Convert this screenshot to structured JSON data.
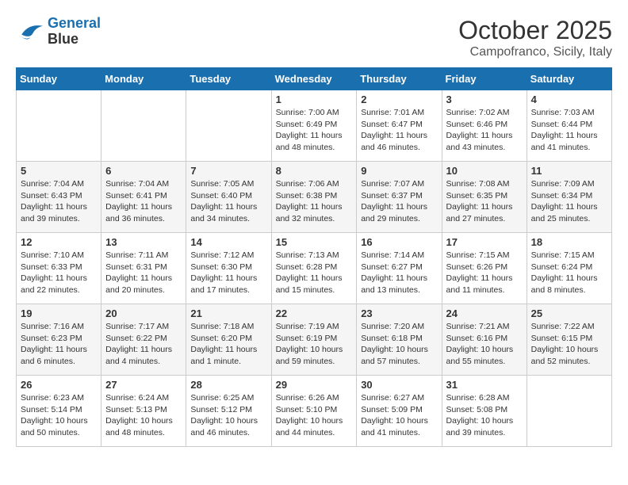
{
  "header": {
    "logo_line1": "General",
    "logo_line2": "Blue",
    "month": "October 2025",
    "location": "Campofranco, Sicily, Italy"
  },
  "weekdays": [
    "Sunday",
    "Monday",
    "Tuesday",
    "Wednesday",
    "Thursday",
    "Friday",
    "Saturday"
  ],
  "weeks": [
    [
      {
        "day": "",
        "info": ""
      },
      {
        "day": "",
        "info": ""
      },
      {
        "day": "",
        "info": ""
      },
      {
        "day": "1",
        "info": "Sunrise: 7:00 AM\nSunset: 6:49 PM\nDaylight: 11 hours\nand 48 minutes."
      },
      {
        "day": "2",
        "info": "Sunrise: 7:01 AM\nSunset: 6:47 PM\nDaylight: 11 hours\nand 46 minutes."
      },
      {
        "day": "3",
        "info": "Sunrise: 7:02 AM\nSunset: 6:46 PM\nDaylight: 11 hours\nand 43 minutes."
      },
      {
        "day": "4",
        "info": "Sunrise: 7:03 AM\nSunset: 6:44 PM\nDaylight: 11 hours\nand 41 minutes."
      }
    ],
    [
      {
        "day": "5",
        "info": "Sunrise: 7:04 AM\nSunset: 6:43 PM\nDaylight: 11 hours\nand 39 minutes."
      },
      {
        "day": "6",
        "info": "Sunrise: 7:04 AM\nSunset: 6:41 PM\nDaylight: 11 hours\nand 36 minutes."
      },
      {
        "day": "7",
        "info": "Sunrise: 7:05 AM\nSunset: 6:40 PM\nDaylight: 11 hours\nand 34 minutes."
      },
      {
        "day": "8",
        "info": "Sunrise: 7:06 AM\nSunset: 6:38 PM\nDaylight: 11 hours\nand 32 minutes."
      },
      {
        "day": "9",
        "info": "Sunrise: 7:07 AM\nSunset: 6:37 PM\nDaylight: 11 hours\nand 29 minutes."
      },
      {
        "day": "10",
        "info": "Sunrise: 7:08 AM\nSunset: 6:35 PM\nDaylight: 11 hours\nand 27 minutes."
      },
      {
        "day": "11",
        "info": "Sunrise: 7:09 AM\nSunset: 6:34 PM\nDaylight: 11 hours\nand 25 minutes."
      }
    ],
    [
      {
        "day": "12",
        "info": "Sunrise: 7:10 AM\nSunset: 6:33 PM\nDaylight: 11 hours\nand 22 minutes."
      },
      {
        "day": "13",
        "info": "Sunrise: 7:11 AM\nSunset: 6:31 PM\nDaylight: 11 hours\nand 20 minutes."
      },
      {
        "day": "14",
        "info": "Sunrise: 7:12 AM\nSunset: 6:30 PM\nDaylight: 11 hours\nand 17 minutes."
      },
      {
        "day": "15",
        "info": "Sunrise: 7:13 AM\nSunset: 6:28 PM\nDaylight: 11 hours\nand 15 minutes."
      },
      {
        "day": "16",
        "info": "Sunrise: 7:14 AM\nSunset: 6:27 PM\nDaylight: 11 hours\nand 13 minutes."
      },
      {
        "day": "17",
        "info": "Sunrise: 7:15 AM\nSunset: 6:26 PM\nDaylight: 11 hours\nand 11 minutes."
      },
      {
        "day": "18",
        "info": "Sunrise: 7:15 AM\nSunset: 6:24 PM\nDaylight: 11 hours\nand 8 minutes."
      }
    ],
    [
      {
        "day": "19",
        "info": "Sunrise: 7:16 AM\nSunset: 6:23 PM\nDaylight: 11 hours\nand 6 minutes."
      },
      {
        "day": "20",
        "info": "Sunrise: 7:17 AM\nSunset: 6:22 PM\nDaylight: 11 hours\nand 4 minutes."
      },
      {
        "day": "21",
        "info": "Sunrise: 7:18 AM\nSunset: 6:20 PM\nDaylight: 11 hours\nand 1 minute."
      },
      {
        "day": "22",
        "info": "Sunrise: 7:19 AM\nSunset: 6:19 PM\nDaylight: 10 hours\nand 59 minutes."
      },
      {
        "day": "23",
        "info": "Sunrise: 7:20 AM\nSunset: 6:18 PM\nDaylight: 10 hours\nand 57 minutes."
      },
      {
        "day": "24",
        "info": "Sunrise: 7:21 AM\nSunset: 6:16 PM\nDaylight: 10 hours\nand 55 minutes."
      },
      {
        "day": "25",
        "info": "Sunrise: 7:22 AM\nSunset: 6:15 PM\nDaylight: 10 hours\nand 52 minutes."
      }
    ],
    [
      {
        "day": "26",
        "info": "Sunrise: 6:23 AM\nSunset: 5:14 PM\nDaylight: 10 hours\nand 50 minutes."
      },
      {
        "day": "27",
        "info": "Sunrise: 6:24 AM\nSunset: 5:13 PM\nDaylight: 10 hours\nand 48 minutes."
      },
      {
        "day": "28",
        "info": "Sunrise: 6:25 AM\nSunset: 5:12 PM\nDaylight: 10 hours\nand 46 minutes."
      },
      {
        "day": "29",
        "info": "Sunrise: 6:26 AM\nSunset: 5:10 PM\nDaylight: 10 hours\nand 44 minutes."
      },
      {
        "day": "30",
        "info": "Sunrise: 6:27 AM\nSunset: 5:09 PM\nDaylight: 10 hours\nand 41 minutes."
      },
      {
        "day": "31",
        "info": "Sunrise: 6:28 AM\nSunset: 5:08 PM\nDaylight: 10 hours\nand 39 minutes."
      },
      {
        "day": "",
        "info": ""
      }
    ]
  ]
}
